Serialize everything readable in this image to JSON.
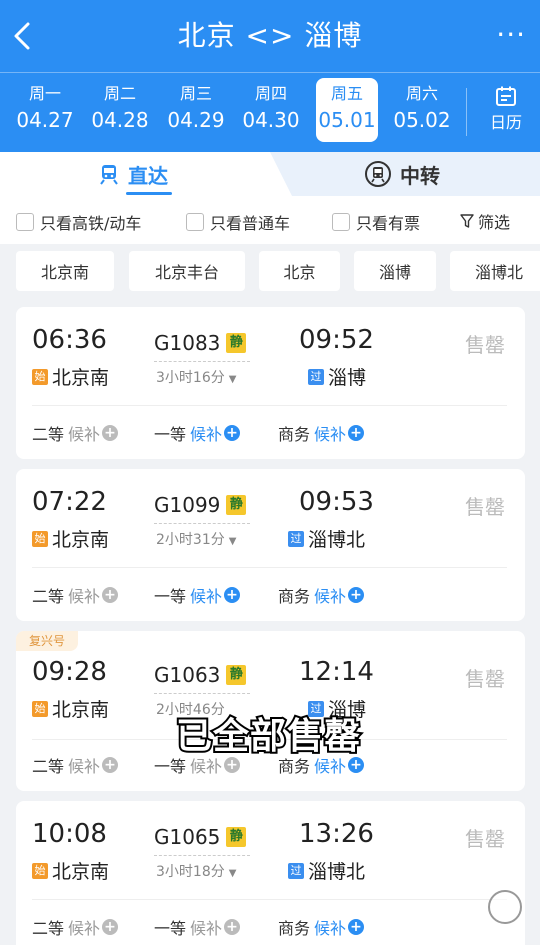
{
  "header": {
    "title": "北京 <> 淄博",
    "more": "···"
  },
  "dates": [
    {
      "weekday": "周一",
      "date": "04.27"
    },
    {
      "weekday": "周二",
      "date": "04.28"
    },
    {
      "weekday": "周三",
      "date": "04.29"
    },
    {
      "weekday": "周四",
      "date": "04.30"
    },
    {
      "weekday": "周五",
      "date": "05.01"
    },
    {
      "weekday": "周六",
      "date": "05.02"
    }
  ],
  "calendar_label": "日历",
  "tabs": {
    "direct": "直达",
    "transfer": "中转"
  },
  "filters": {
    "hsr": "只看高铁/动车",
    "normal": "只看普通车",
    "available": "只看有票",
    "filter": "筛选"
  },
  "stations": [
    "北京南",
    "北京丰台",
    "北京",
    "淄博",
    "淄博北"
  ],
  "trains": [
    {
      "dep": "06:36",
      "no": "G1083",
      "quiet": "静",
      "arr": "09:52",
      "dur": "3小时16分",
      "from_badge": "始",
      "from": "北京南",
      "to_badge": "过",
      "to": "淄博",
      "status": "售罄",
      "seats": [
        {
          "cls": "二等",
          "val": "候补"
        },
        {
          "cls": "一等",
          "val": "候补"
        },
        {
          "cls": "商务",
          "val": "候补"
        }
      ]
    },
    {
      "dep": "07:22",
      "no": "G1099",
      "quiet": "静",
      "arr": "09:53",
      "dur": "2小时31分",
      "from_badge": "始",
      "from": "北京南",
      "to_badge": "过",
      "to": "淄博北",
      "status": "售罄",
      "seats": [
        {
          "cls": "二等",
          "val": "候补"
        },
        {
          "cls": "一等",
          "val": "候补"
        },
        {
          "cls": "商务",
          "val": "候补"
        }
      ]
    },
    {
      "tag": "复兴号",
      "dep": "09:28",
      "no": "G1063",
      "quiet": "静",
      "arr": "12:14",
      "dur": "2小时46分",
      "from_badge": "始",
      "from": "北京南",
      "to_badge": "过",
      "to": "淄博",
      "status": "售罄",
      "seats": [
        {
          "cls": "二等",
          "val": "候补"
        },
        {
          "cls": "一等",
          "val": "候补"
        },
        {
          "cls": "商务",
          "val": "候补"
        }
      ]
    },
    {
      "dep": "10:08",
      "no": "G1065",
      "quiet": "静",
      "arr": "13:26",
      "dur": "3小时18分",
      "from_badge": "始",
      "from": "北京南",
      "to_badge": "过",
      "to": "淄博北",
      "status": "售罄",
      "seats": [
        {
          "cls": "二等",
          "val": "候补"
        },
        {
          "cls": "一等",
          "val": "候补"
        },
        {
          "cls": "商务",
          "val": "候补"
        }
      ]
    }
  ],
  "subtitle_text": "已全部售罄"
}
